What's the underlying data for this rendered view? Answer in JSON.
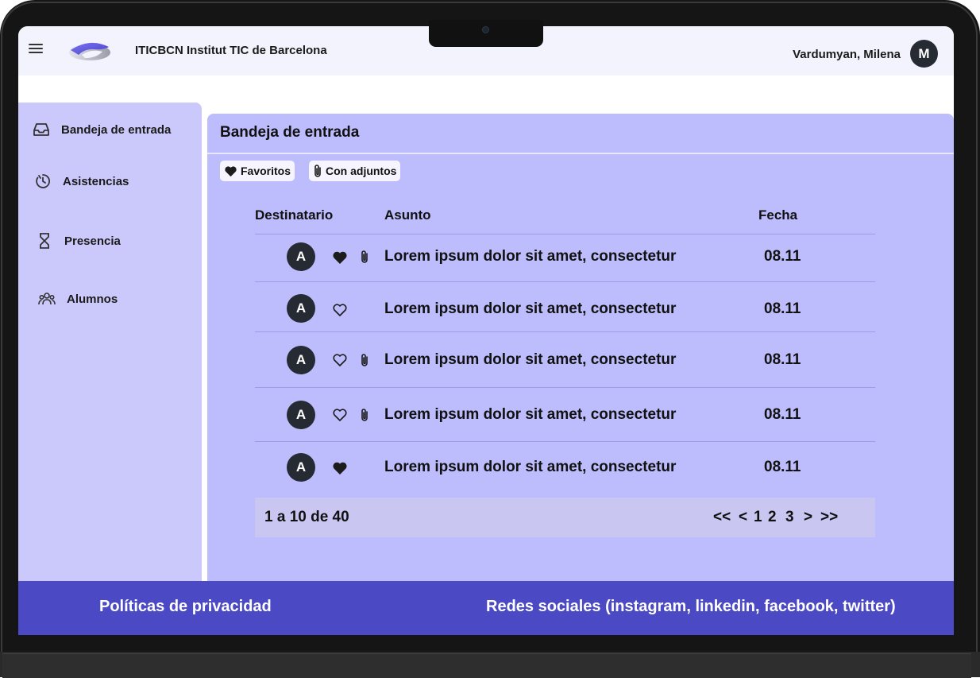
{
  "header": {
    "brand": "ITICBCN Institut TIC de Barcelona",
    "user_name": "Vardumyan, Milena",
    "user_initial": "M"
  },
  "sidebar": {
    "items": [
      {
        "label": "Bandeja de entrada",
        "icon": "inbox-icon"
      },
      {
        "label": "Asistencias",
        "icon": "timer-icon"
      },
      {
        "label": "Presencia",
        "icon": "hourglass-icon"
      },
      {
        "label": "Alumnos",
        "icon": "students-icon"
      }
    ]
  },
  "inbox": {
    "title": "Bandeja de entrada",
    "filters": [
      {
        "label": "Favoritos",
        "icon": "heart-filled-icon"
      },
      {
        "label": "Con adjuntos",
        "icon": "paperclip-icon"
      }
    ],
    "columns": [
      "Destinatario",
      "Asunto",
      "Fecha"
    ],
    "rows": [
      {
        "initial": "A",
        "favorite": true,
        "attachment": true,
        "subject": "Lorem ipsum dolor sit amet, consectetur",
        "date": "08.11"
      },
      {
        "initial": "A",
        "favorite": false,
        "attachment": false,
        "subject": "Lorem ipsum dolor sit amet, consectetur",
        "date": "08.11"
      },
      {
        "initial": "A",
        "favorite": false,
        "attachment": true,
        "subject": "Lorem ipsum dolor sit amet, consectetur",
        "date": "08.11"
      },
      {
        "initial": "A",
        "favorite": false,
        "attachment": true,
        "subject": "Lorem ipsum dolor sit amet, consectetur",
        "date": "08.11"
      },
      {
        "initial": "A",
        "favorite": true,
        "attachment": false,
        "subject": "Lorem ipsum dolor sit amet, consectetur",
        "date": "08.11"
      }
    ],
    "pagination": {
      "summary": "1 a 10 de 40",
      "first": "<<",
      "prev": "<",
      "pages": [
        "1",
        "2",
        "3"
      ],
      "next": ">",
      "last": ">>"
    }
  },
  "footer": {
    "privacy": "Políticas de privacidad",
    "social": "Redes sociales (instagram, linkedin, facebook, twitter)"
  },
  "colors": {
    "sidebar_bg": "#cbc9fb",
    "panel_bg": "#bdbcfc",
    "footer_bg": "#4b49c3",
    "avatar_bg": "#262a33"
  }
}
